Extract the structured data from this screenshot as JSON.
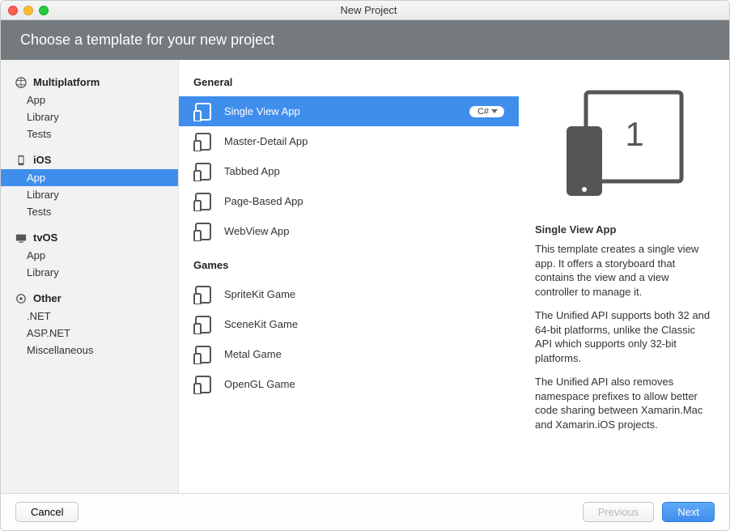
{
  "window": {
    "title": "New Project"
  },
  "header": {
    "title": "Choose a template for your new project"
  },
  "sidebar": {
    "categories": [
      {
        "label": "Multiplatform",
        "items": [
          "App",
          "Library",
          "Tests"
        ]
      },
      {
        "label": "iOS",
        "items": [
          "App",
          "Library",
          "Tests"
        ],
        "selectedIndex": 0
      },
      {
        "label": "tvOS",
        "items": [
          "App",
          "Library"
        ]
      },
      {
        "label": "Other",
        "items": [
          ".NET",
          "ASP.NET",
          "Miscellaneous"
        ]
      }
    ]
  },
  "middle": {
    "groups": [
      {
        "label": "General",
        "items": [
          "Single View App",
          "Master-Detail App",
          "Tabbed App",
          "Page-Based App",
          "WebView App"
        ],
        "selectedIndex": 0
      },
      {
        "label": "Games",
        "items": [
          "SpriteKit Game",
          "SceneKit Game",
          "Metal Game",
          "OpenGL Game"
        ]
      }
    ],
    "badge": "C#"
  },
  "detail": {
    "title": "Single View App",
    "paragraphs": [
      "This template creates a single view app. It offers a storyboard that contains the view and a view controller to manage it.",
      "The Unified API supports both 32 and 64-bit platforms, unlike the Classic API which supports only 32-bit platforms.",
      "The Unified API also removes namespace prefixes to allow better code sharing between Xamarin.Mac and Xamarin.iOS projects."
    ],
    "illustration_digit": "1"
  },
  "footer": {
    "cancel": "Cancel",
    "previous": "Previous",
    "next": "Next"
  }
}
